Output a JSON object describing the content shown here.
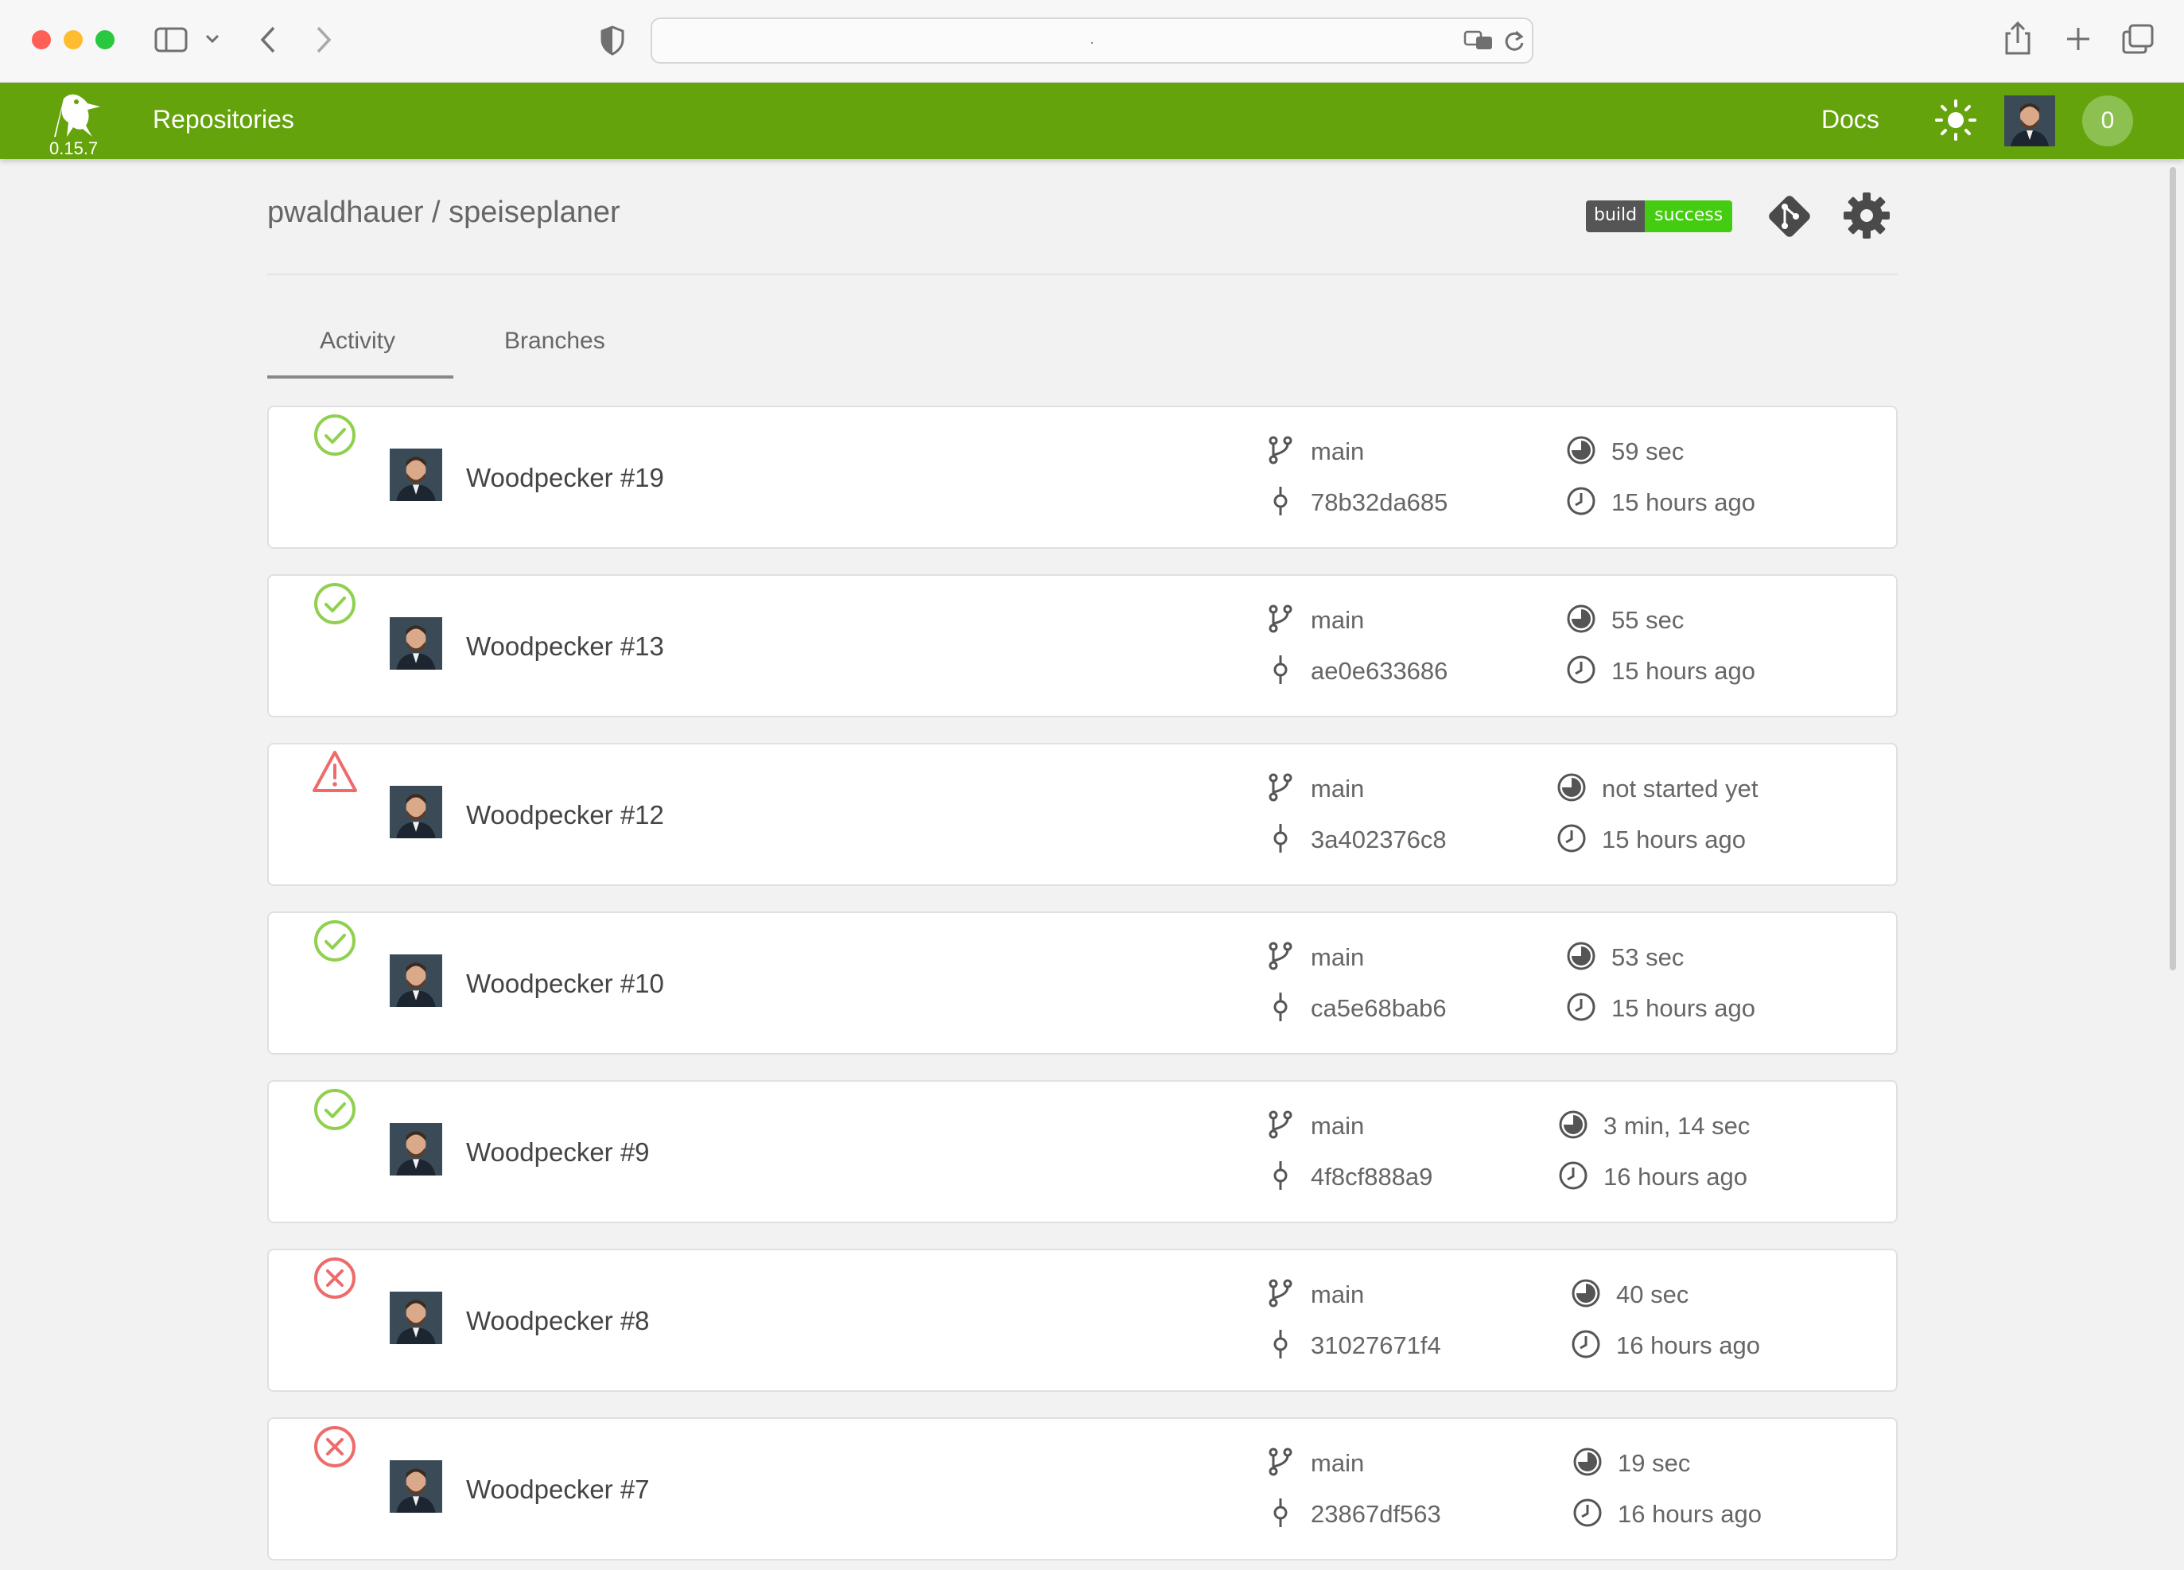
{
  "browser": {
    "url_text": "."
  },
  "app": {
    "version": "0.15.7",
    "nav_repositories": "Repositories",
    "nav_docs": "Docs",
    "pipeline_count": "0"
  },
  "repo": {
    "owner": "pwaldhauer",
    "name": "speiseplaner",
    "full_name": "pwaldhauer / speiseplaner",
    "badge_left": "build",
    "badge_right": "success"
  },
  "tabs": {
    "activity": "Activity",
    "branches": "Branches"
  },
  "colors": {
    "header_green": "#65a30d",
    "success": "#8fd14f",
    "error": "#ef6b6b",
    "badge_green": "#44cc11"
  },
  "builds": [
    {
      "status": "success",
      "status_icon": "check-circle-icon",
      "title": "Woodpecker #19",
      "branch": "main",
      "commit": "78b32da685",
      "duration": "59 sec",
      "started": "15 hours ago"
    },
    {
      "status": "success",
      "status_icon": "check-circle-icon",
      "title": "Woodpecker #13",
      "branch": "main",
      "commit": "ae0e633686",
      "duration": "55 sec",
      "started": "15 hours ago"
    },
    {
      "status": "error",
      "status_icon": "warning-triangle-icon",
      "title": "Woodpecker #12",
      "branch": "main",
      "commit": "3a402376c8",
      "duration": "not started yet",
      "started": "15 hours ago"
    },
    {
      "status": "success",
      "status_icon": "check-circle-icon",
      "title": "Woodpecker #10",
      "branch": "main",
      "commit": "ca5e68bab6",
      "duration": "53 sec",
      "started": "15 hours ago"
    },
    {
      "status": "success",
      "status_icon": "check-circle-icon",
      "title": "Woodpecker #9",
      "branch": "main",
      "commit": "4f8cf888a9",
      "duration": "3 min, 14 sec",
      "started": "16 hours ago"
    },
    {
      "status": "failure",
      "status_icon": "x-circle-icon",
      "title": "Woodpecker #8",
      "branch": "main",
      "commit": "31027671f4",
      "duration": "40 sec",
      "started": "16 hours ago"
    },
    {
      "status": "failure",
      "status_icon": "x-circle-icon",
      "title": "Woodpecker #7",
      "branch": "main",
      "commit": "23867df563",
      "duration": "19 sec",
      "started": "16 hours ago"
    }
  ]
}
